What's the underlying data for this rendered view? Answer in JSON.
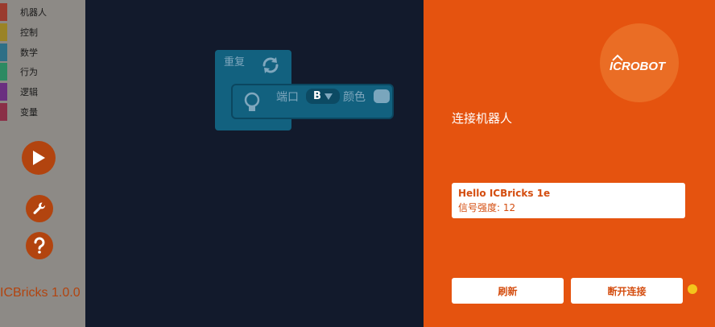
{
  "sidebar": {
    "categories": [
      {
        "label": "机器人",
        "color": "#9a3b2e"
      },
      {
        "label": "控制",
        "color": "#9a8326"
      },
      {
        "label": "数学",
        "color": "#2e6f86"
      },
      {
        "label": "行为",
        "color": "#2c8a62"
      },
      {
        "label": "逻辑",
        "color": "#6a2f80"
      },
      {
        "label": "变量",
        "color": "#8a2f47"
      }
    ],
    "version": "ICBricks 1.0.0"
  },
  "workspace": {
    "repeat_label": "重复",
    "led_port_label": "端口",
    "led_port_value": "B",
    "led_color_label": "颜色"
  },
  "panel": {
    "logo": "ICROBOT",
    "title": "连接机器人",
    "device": {
      "name": "Hello ICBricks 1e",
      "signal": "信号强度: 12"
    },
    "refresh_label": "刷新",
    "disconnect_label": "断开连接",
    "status_color": "#f3c61c"
  }
}
